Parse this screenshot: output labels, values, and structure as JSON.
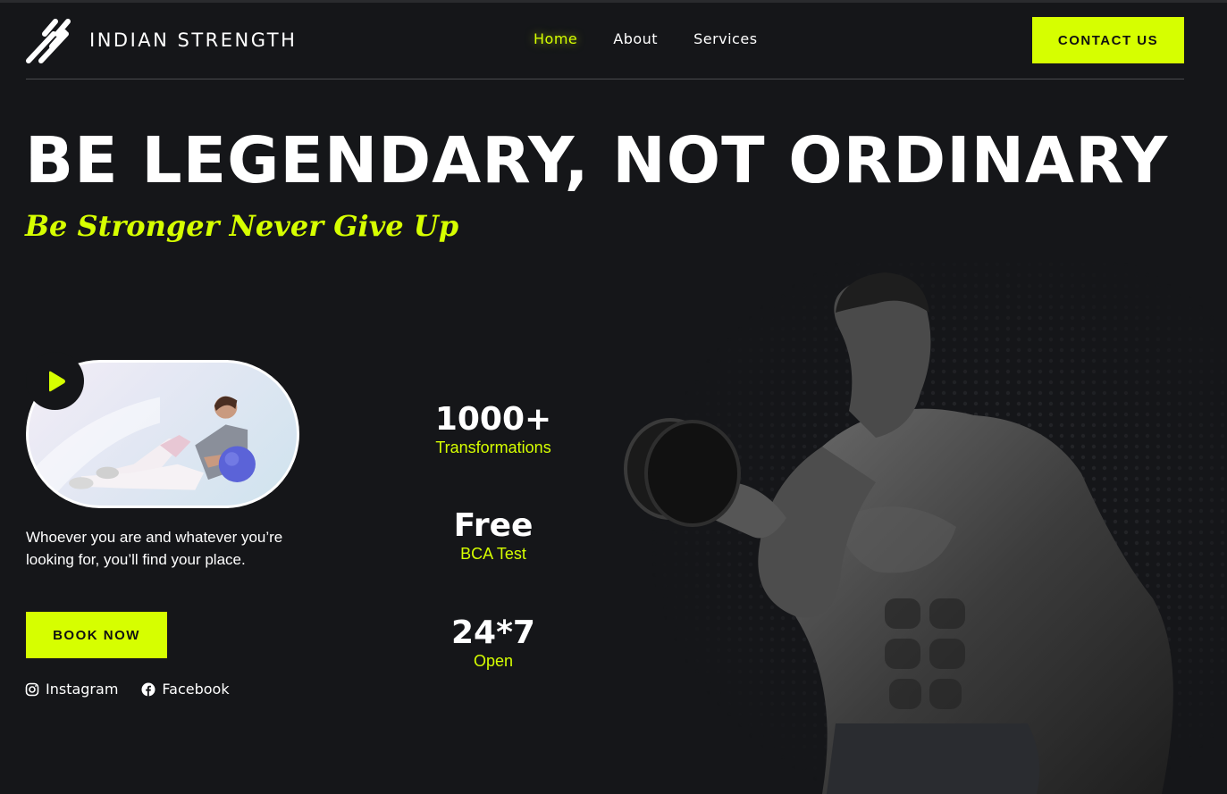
{
  "brand": {
    "name": "INDIAN STRENGTH",
    "logo_icon": "slash-stripes-logo",
    "accent_color": "#d6ff00",
    "background_color": "#151619"
  },
  "nav": {
    "items": [
      {
        "label": "Home",
        "active": true
      },
      {
        "label": "About",
        "active": false
      },
      {
        "label": "Services",
        "active": false
      }
    ],
    "contact_label": "CONTACT US"
  },
  "hero": {
    "headline": "BE LEGENDARY, NOT ORDINARY",
    "tagline": "Be Stronger Never Give Up",
    "video": {
      "play_icon": "play-icon"
    },
    "description": "Whoever you are and whatever you’re looking for, you’ll find your place.",
    "book_label": "BOOK NOW",
    "socials": [
      {
        "icon": "instagram-icon",
        "label": "Instagram"
      },
      {
        "icon": "facebook-icon",
        "label": "Facebook"
      }
    ]
  },
  "stats": [
    {
      "value": "1000+",
      "label": "Transformations"
    },
    {
      "value": "Free",
      "label": "BCA Test"
    },
    {
      "value": "24*7",
      "label": "Open"
    }
  ]
}
